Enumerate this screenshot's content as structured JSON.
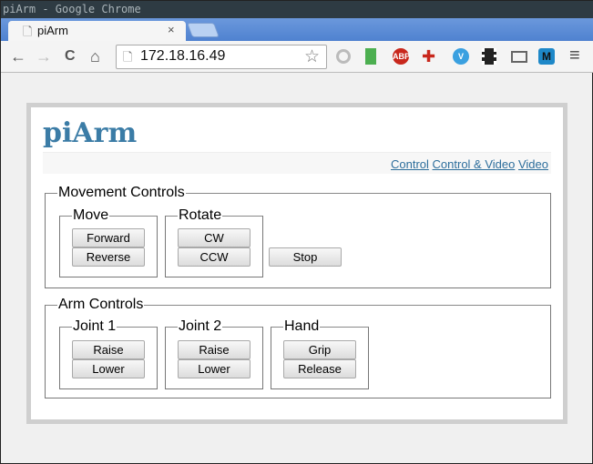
{
  "window": {
    "title": "piArm - Google Chrome"
  },
  "tab": {
    "label": "piArm",
    "close": "×"
  },
  "toolbar": {
    "url": "172.18.16.49",
    "back": "←",
    "forward": "→",
    "reload": "C",
    "home": "⌂",
    "star": "☆",
    "menu": "≡",
    "extensions": [
      {
        "icon": "abp-icon",
        "label": "ABP",
        "color": "#c8271c"
      },
      {
        "icon": "vimeo-icon",
        "label": "V",
        "color": "#3aa0e0"
      },
      {
        "icon": "m-icon",
        "label": "M",
        "color": "#1e88c8"
      }
    ]
  },
  "page": {
    "logo": "piArm",
    "nav": [
      "Control",
      "Control & Video",
      "Video"
    ]
  },
  "movement": {
    "legend": "Movement Controls",
    "move": {
      "legend": "Move",
      "buttons": [
        "Forward",
        "Reverse"
      ]
    },
    "rotate": {
      "legend": "Rotate",
      "buttons": [
        "CW",
        "CCW"
      ]
    },
    "stop": "Stop"
  },
  "arm": {
    "legend": "Arm Controls",
    "joint1": {
      "legend": "Joint 1",
      "buttons": [
        "Raise",
        "Lower"
      ]
    },
    "joint2": {
      "legend": "Joint 2",
      "buttons": [
        "Raise",
        "Lower"
      ]
    },
    "hand": {
      "legend": "Hand",
      "buttons": [
        "Grip",
        "Release"
      ]
    }
  }
}
